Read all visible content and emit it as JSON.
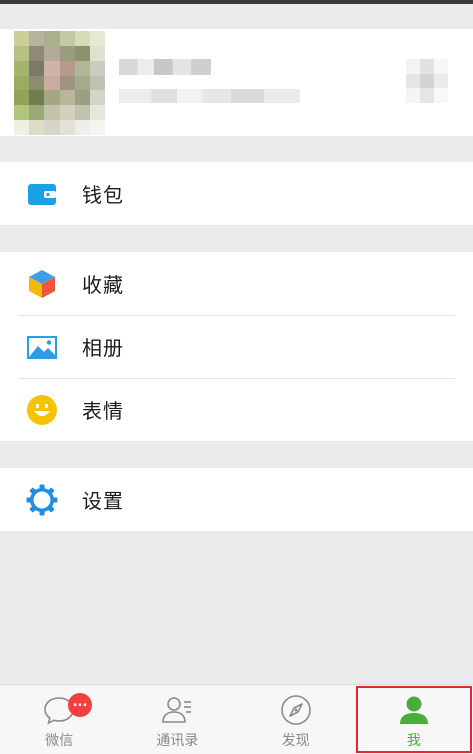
{
  "profile": {
    "avatar_cells": [
      "#c9d09a",
      "#b8b49c",
      "#a9b08c",
      "#c5c9a3",
      "#d7dcb8",
      "#e6e8d1",
      "#b4c084",
      "#8f8a76",
      "#b4a99a",
      "#9a9c7e",
      "#8c9170",
      "#dfe2cc",
      "#a2b56d",
      "#7a7a66",
      "#d0b2a8",
      "#b79a8a",
      "#b3b696",
      "#c9ccc0",
      "#98ad5e",
      "#8b8d6e",
      "#c9aba2",
      "#9f9383",
      "#a6a98a",
      "#bfc2b2",
      "#8fa454",
      "#6f7e4f",
      "#a3a782",
      "#b9b69e",
      "#9aa086",
      "#d3d6c6",
      "#b3c57c",
      "#9aaa72",
      "#c3c3ab",
      "#d2d1c0",
      "#c0c2b0",
      "#e5e6dc",
      "#eef0e2",
      "#dcdcc8",
      "#d6d6c8",
      "#e2e2d8",
      "#eeeeea",
      "#f4f4f0"
    ],
    "qr_cells": [
      "#f3f3f3",
      "#e2e2e2",
      "#f6f6f6",
      "#e6e6e6",
      "#d4d4d4",
      "#ebebeb",
      "#f5f5f5",
      "#e5e5e5",
      "#f8f8f8"
    ]
  },
  "menu": {
    "wallet_label": "钱包",
    "favorites_label": "收藏",
    "album_label": "相册",
    "stickers_label": "表情",
    "settings_label": "设置"
  },
  "tabbar": {
    "chats_label": "微信",
    "chats_badge": "...",
    "contacts_label": "通讯录",
    "discover_label": "发现",
    "me_label": "我"
  },
  "colors": {
    "accent_green": "#45b035",
    "badge_red": "#f2403c",
    "highlight_box": "#e02a2a",
    "wallet_blue": "#1aa1e8",
    "settings_blue": "#1e8ee0",
    "sticker_yellow": "#f5c400"
  }
}
